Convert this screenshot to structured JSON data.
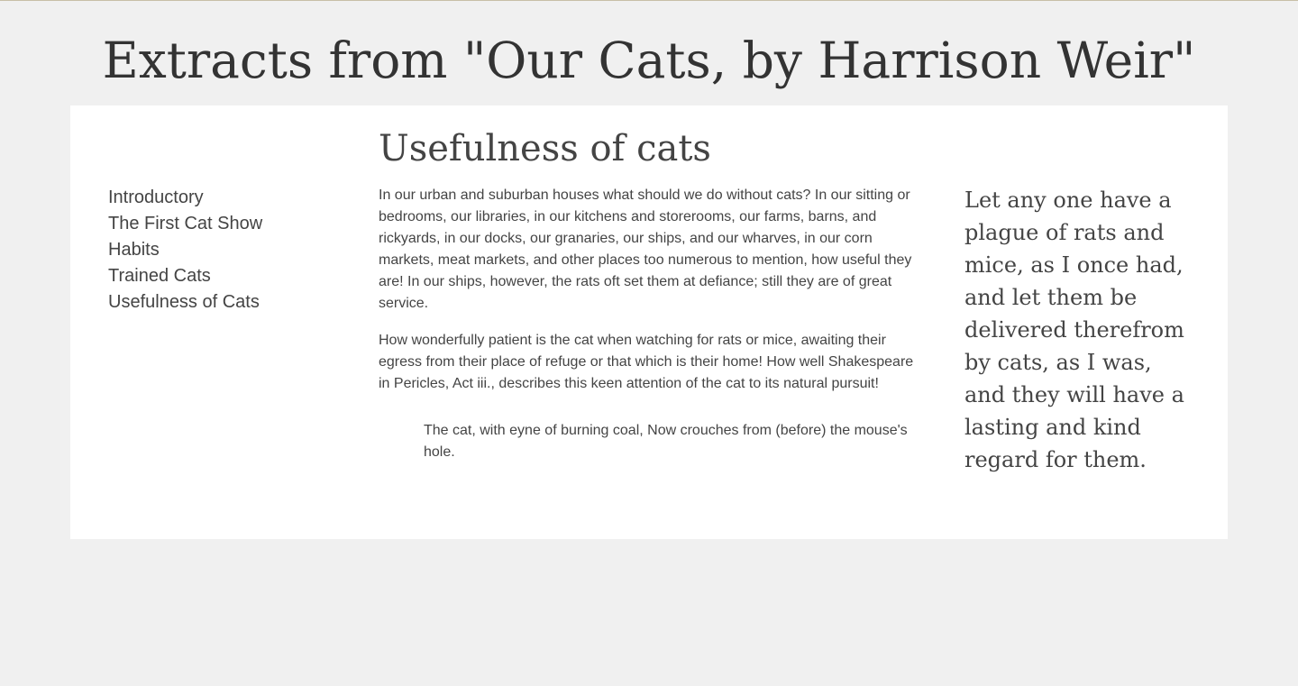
{
  "site": {
    "title": "Extracts from \"Our Cats, by Harrison Weir\""
  },
  "nav": {
    "items": [
      {
        "label": "Introductory"
      },
      {
        "label": "The First Cat Show"
      },
      {
        "label": "Habits"
      },
      {
        "label": "Trained Cats"
      },
      {
        "label": "Usefulness of Cats"
      }
    ]
  },
  "article": {
    "title": "Usefulness of cats",
    "paragraphs": [
      "In our urban and suburban houses what should we do without cats? In our sitting or bedrooms, our libraries, in our kitchens and storerooms, our farms, barns, and rickyards, in our docks, our granaries, our ships, and our wharves, in our corn markets, meat markets, and other places too numerous to mention, how useful they are! In our ships, however, the rats oft set them at defiance; still they are of great service.",
      "How wonderfully patient is the cat when watching for rats or mice, awaiting their egress from their place of refuge or that which is their home! How well Shakespeare in Pericles, Act iii., describes this keen attention of the cat to its natural pursuit!"
    ],
    "quote": "The cat, with eyne of burning coal, Now crouches from (before) the mouse's hole."
  },
  "aside": {
    "text": "Let any one have a plague of rats and mice, as I once had, and let them be delivered therefrom by cats, as I was, and they will have a lasting and kind regard for them."
  }
}
